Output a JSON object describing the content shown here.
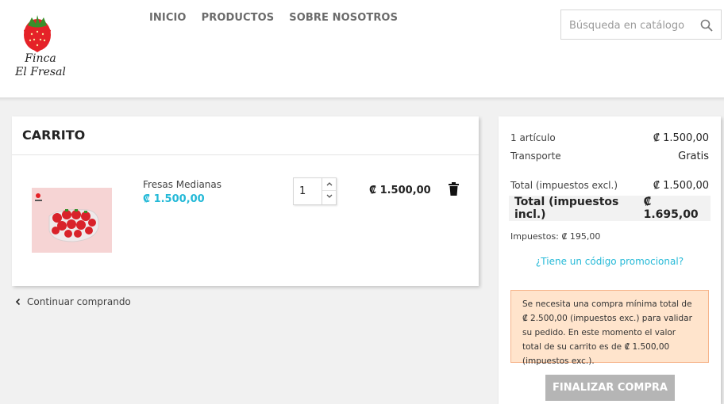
{
  "header": {
    "logo_text": [
      "Finca",
      "El Fresal"
    ],
    "nav": [
      "INICIO",
      "PRODUCTOS",
      "SOBRE NOSOTROS"
    ],
    "search_placeholder": "Búsqueda en catálogo",
    "search_icon": "magnifier-icon"
  },
  "cart": {
    "title": "CARRITO",
    "items": [
      {
        "name": "Fresas Medianas",
        "unit_price": "₡ 1.500,00",
        "quantity": "1",
        "line_total": "₡ 1.500,00"
      }
    ],
    "continue_label": "Continuar comprando"
  },
  "summary": {
    "items_label": "1 artículo",
    "items_value": "₡ 1.500,00",
    "shipping_label": "Transporte",
    "shipping_value": "Gratis",
    "total_excl_label": "Total (impuestos excl.)",
    "total_excl_value": "₡ 1.500,00",
    "total_incl_label": "Total (impuestos incl.)",
    "total_incl_value": "₡ 1.695,00",
    "taxes": "Impuestos: ₡ 195,00",
    "promo_link": "¿Tiene un código promocional?",
    "min_order_alert": "Se necesita una compra mínima total de ₡ 2.500,00 (impuestos exc.) para validar su pedido. En este momento el valor total de su carrito es de ₡ 1.500,00 (impuestos exc.).",
    "checkout_label": "FINALIZAR COMPRA"
  },
  "colors": {
    "accent": "#24b9d7",
    "alert_bg": "#ffe4cc",
    "button_disabled": "#b5b5b5"
  }
}
